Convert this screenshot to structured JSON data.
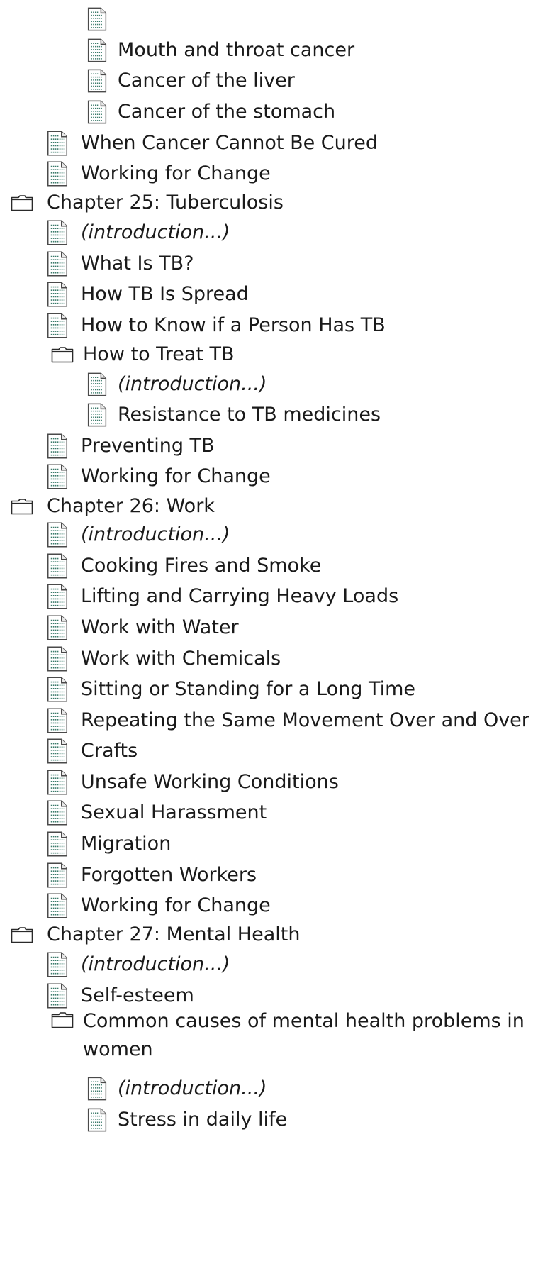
{
  "tree": {
    "items": [
      {
        "kind": "doc",
        "level": 2,
        "label": "",
        "intro": false
      },
      {
        "kind": "doc",
        "level": 2,
        "label": "Mouth and throat cancer",
        "intro": false
      },
      {
        "kind": "doc",
        "level": 2,
        "label": "Cancer of the liver",
        "intro": false
      },
      {
        "kind": "doc",
        "level": 2,
        "label": "Cancer of the stomach",
        "intro": false
      },
      {
        "kind": "doc",
        "level": 1,
        "label": "When Cancer Cannot Be Cured",
        "intro": false
      },
      {
        "kind": "doc",
        "level": 1,
        "label": "Working for Change",
        "intro": false
      },
      {
        "kind": "folder",
        "level": 0,
        "label": "Chapter 25: Tuberculosis",
        "intro": false
      },
      {
        "kind": "doc",
        "level": 1,
        "label": "(introduction...)",
        "intro": true
      },
      {
        "kind": "doc",
        "level": 1,
        "label": "What Is TB?",
        "intro": false
      },
      {
        "kind": "doc",
        "level": 1,
        "label": "How TB Is Spread",
        "intro": false
      },
      {
        "kind": "doc",
        "level": 1,
        "label": "How to Know if a Person Has TB",
        "intro": false
      },
      {
        "kind": "folder",
        "level": 1,
        "label": "How to Treat TB",
        "intro": false
      },
      {
        "kind": "doc",
        "level": 2,
        "label": "(introduction...)",
        "intro": true
      },
      {
        "kind": "doc",
        "level": 2,
        "label": "Resistance to TB medicines",
        "intro": false
      },
      {
        "kind": "doc",
        "level": 1,
        "label": "Preventing TB",
        "intro": false
      },
      {
        "kind": "doc",
        "level": 1,
        "label": "Working for Change",
        "intro": false
      },
      {
        "kind": "folder",
        "level": 0,
        "label": "Chapter 26: Work",
        "intro": false
      },
      {
        "kind": "doc",
        "level": 1,
        "label": "(introduction...)",
        "intro": true
      },
      {
        "kind": "doc",
        "level": 1,
        "label": "Cooking Fires and Smoke",
        "intro": false
      },
      {
        "kind": "doc",
        "level": 1,
        "label": "Lifting and Carrying Heavy Loads",
        "intro": false
      },
      {
        "kind": "doc",
        "level": 1,
        "label": "Work with Water",
        "intro": false
      },
      {
        "kind": "doc",
        "level": 1,
        "label": "Work with Chemicals",
        "intro": false
      },
      {
        "kind": "doc",
        "level": 1,
        "label": "Sitting or Standing for a Long Time",
        "intro": false
      },
      {
        "kind": "doc",
        "level": 1,
        "label": "Repeating the Same Movement Over and Over",
        "intro": false
      },
      {
        "kind": "doc",
        "level": 1,
        "label": "Crafts",
        "intro": false
      },
      {
        "kind": "doc",
        "level": 1,
        "label": "Unsafe Working Conditions",
        "intro": false
      },
      {
        "kind": "doc",
        "level": 1,
        "label": "Sexual Harassment",
        "intro": false
      },
      {
        "kind": "doc",
        "level": 1,
        "label": "Migration",
        "intro": false
      },
      {
        "kind": "doc",
        "level": 1,
        "label": "Forgotten Workers",
        "intro": false
      },
      {
        "kind": "doc",
        "level": 1,
        "label": "Working for Change",
        "intro": false
      },
      {
        "kind": "folder",
        "level": 0,
        "label": "Chapter 27: Mental Health",
        "intro": false
      },
      {
        "kind": "doc",
        "level": 1,
        "label": "(introduction...)",
        "intro": true
      },
      {
        "kind": "doc",
        "level": 1,
        "label": "Self-esteem",
        "intro": false
      },
      {
        "kind": "folder",
        "level": 1,
        "label": "Common causes of mental health problems in women",
        "intro": false
      },
      {
        "kind": "doc",
        "level": 2,
        "label": "(introduction...)",
        "intro": true
      },
      {
        "kind": "doc",
        "level": 2,
        "label": "Stress in daily life",
        "intro": false
      }
    ]
  },
  "icons": {
    "doc": "document-icon",
    "folder": "folder-icon"
  },
  "colors": {
    "text": "#1a1a1a",
    "doc_outline": "#4a4a4a",
    "doc_lines": "#3a7a6a",
    "folder_outline": "#2a2a2a"
  }
}
